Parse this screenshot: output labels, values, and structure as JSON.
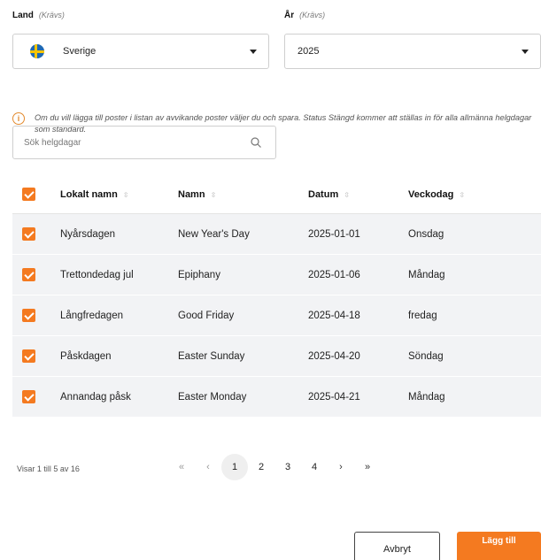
{
  "form": {
    "country": {
      "label": "Land",
      "required": "(Krävs)",
      "value": "Sverige",
      "flag_icon": "sweden-flag-icon"
    },
    "year": {
      "label": "År",
      "required": "(Krävs)",
      "value": "2025"
    }
  },
  "info": {
    "icon": "info-icon",
    "text": "Om du vill lägga till poster i listan av avvikande poster väljer du och spara. Status Stängd kommer att ställas in för alla allmänna helgdagar som standard."
  },
  "search": {
    "placeholder": "Sök helgdagar",
    "value": ""
  },
  "table": {
    "headers": [
      "Lokalt namn",
      "Namn",
      "Datum",
      "Veckodag"
    ],
    "sort_icon": "⇳",
    "rows": [
      {
        "local": "Nyårsdagen",
        "name": "New Year's Day",
        "date": "2025-01-01",
        "weekday": "Onsdag"
      },
      {
        "local": "Trettondedag jul",
        "name": "Epiphany",
        "date": "2025-01-06",
        "weekday": "Måndag"
      },
      {
        "local": "Långfredagen",
        "name": "Good Friday",
        "date": "2025-04-18",
        "weekday": "fredag"
      },
      {
        "local": "Påskdagen",
        "name": "Easter Sunday",
        "date": "2025-04-20",
        "weekday": "Söndag"
      },
      {
        "local": "Annandag påsk",
        "name": "Easter Monday",
        "date": "2025-04-21",
        "weekday": "Måndag"
      }
    ]
  },
  "pagination": {
    "summary": "Visar 1 till 5 av 16",
    "first": "«",
    "prev": "‹",
    "pages": [
      "1",
      "2",
      "3",
      "4"
    ],
    "active_page": "1",
    "next": "›",
    "last": "»"
  },
  "actions": {
    "cancel": "Avbryt",
    "add": "Lägg till"
  },
  "colors": {
    "accent": "#f47a20",
    "row_bg": "#f2f3f5",
    "info": "#e38a2e"
  }
}
